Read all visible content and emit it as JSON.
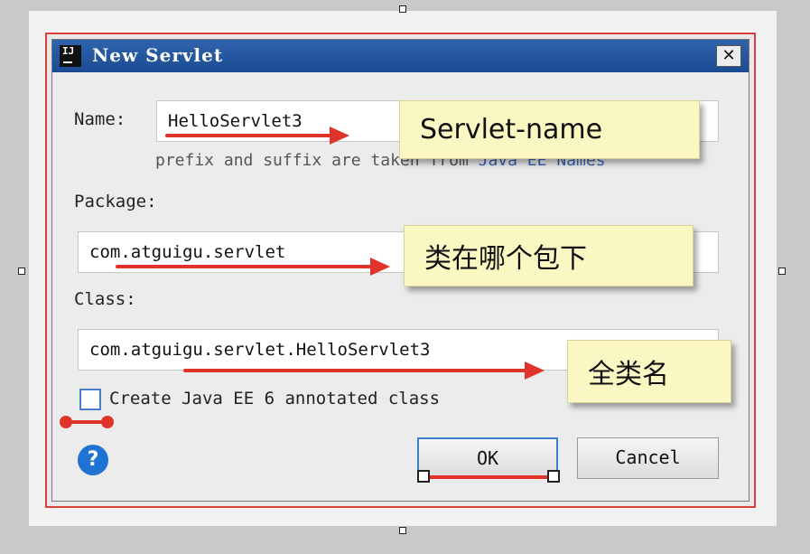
{
  "dialog": {
    "title": "New Servlet",
    "icon_text": "IJ",
    "close_glyph": "✕"
  },
  "fields": {
    "name_label": "Name:",
    "name_value": "HelloServlet3",
    "hint_prefix": "prefix and suffix are taken from",
    "hint_link": "Java EE Names",
    "package_label": "Package:",
    "package_value": "com.atguigu.servlet",
    "class_label": "Class:",
    "class_value": "com.atguigu.servlet.HelloServlet3"
  },
  "options": {
    "annotated_label": "Create Java EE 6 annotated class",
    "annotated_checked": false
  },
  "buttons": {
    "help_glyph": "?",
    "ok_label": "OK",
    "cancel_label": "Cancel"
  },
  "annotations": {
    "name_note": "Servlet-name",
    "package_note": "类在哪个包下",
    "class_note": "全类名"
  },
  "colors": {
    "accent": "#e0342a",
    "title_bar": "#2f64ad",
    "note_bg": "#fbf7c2"
  }
}
